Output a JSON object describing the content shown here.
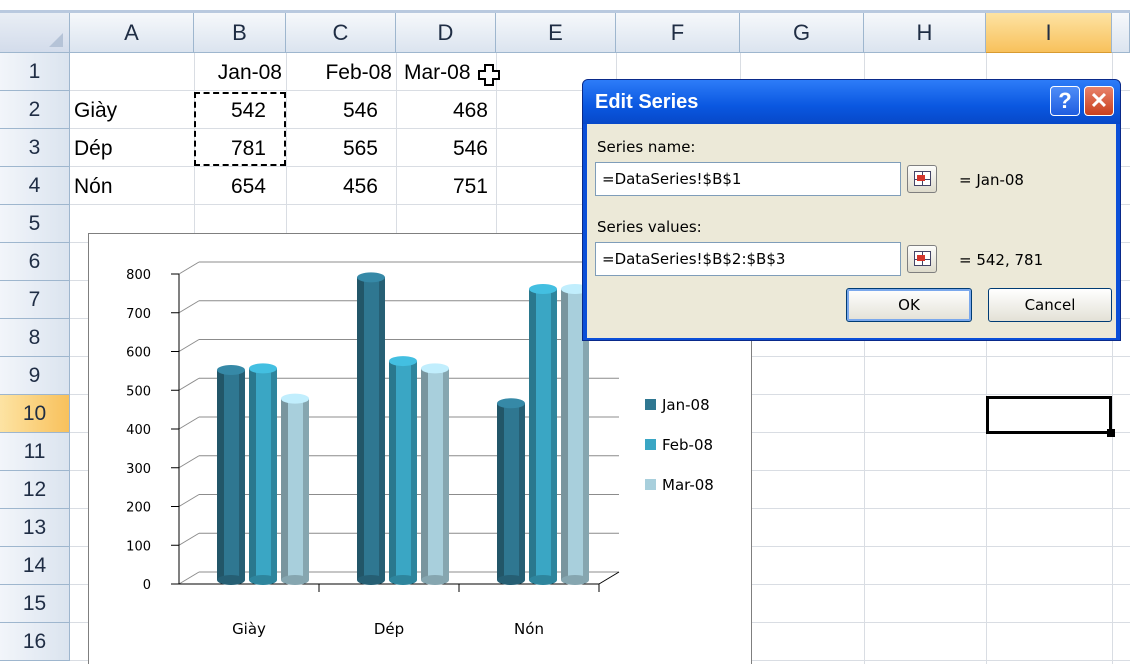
{
  "columns": [
    "A",
    "B",
    "C",
    "D",
    "E",
    "F",
    "G",
    "H",
    "I"
  ],
  "selected_column": "I",
  "rows": [
    "1",
    "2",
    "3",
    "4",
    "5",
    "6",
    "7",
    "8",
    "9",
    "10",
    "11",
    "12",
    "13",
    "14",
    "15",
    "16"
  ],
  "selected_row": "10",
  "cells": {
    "B1": "Jan-08",
    "C1": "Feb-08",
    "D1": "Mar-08",
    "A2": "Giày",
    "B2": "542",
    "C2": "546",
    "D2": "468",
    "A3": "Dép",
    "B3": "781",
    "C3": "565",
    "D3": "546",
    "A4": "Nón",
    "B4": "654",
    "C4": "456",
    "D4": "751"
  },
  "chart_data": {
    "type": "bar",
    "categories": [
      "Giày",
      "Dép",
      "Nón"
    ],
    "series": [
      {
        "name": "Jan-08",
        "values": [
          542,
          781,
          456
        ],
        "color": "#2f7791"
      },
      {
        "name": "Feb-08",
        "values": [
          546,
          565,
          751
        ],
        "color": "#3aa6c4"
      },
      {
        "name": "Mar-08",
        "values": [
          468,
          546,
          751
        ],
        "color": "#a8cfdc"
      }
    ],
    "yticks": [
      "0",
      "100",
      "200",
      "300",
      "400",
      "500",
      "600",
      "700",
      "800"
    ],
    "ylim": [
      0,
      800
    ],
    "legend_position": "right",
    "grid": true
  },
  "dialog": {
    "title": "Edit Series",
    "help_label": "?",
    "close_label": "✕",
    "series_name_label": "Series name:",
    "series_name_value": "=DataSeries!$B$1",
    "series_name_preview": "= Jan-08",
    "series_values_label": "Series values:",
    "series_values_value": "=DataSeries!$B$2:$B$3",
    "series_values_preview": "= 542, 781",
    "ok_label": "OK",
    "cancel_label": "Cancel"
  },
  "icons": {
    "collapse_dialog": "collapse-dialog-icon",
    "cursor": "cell-cursor-plus-icon"
  }
}
